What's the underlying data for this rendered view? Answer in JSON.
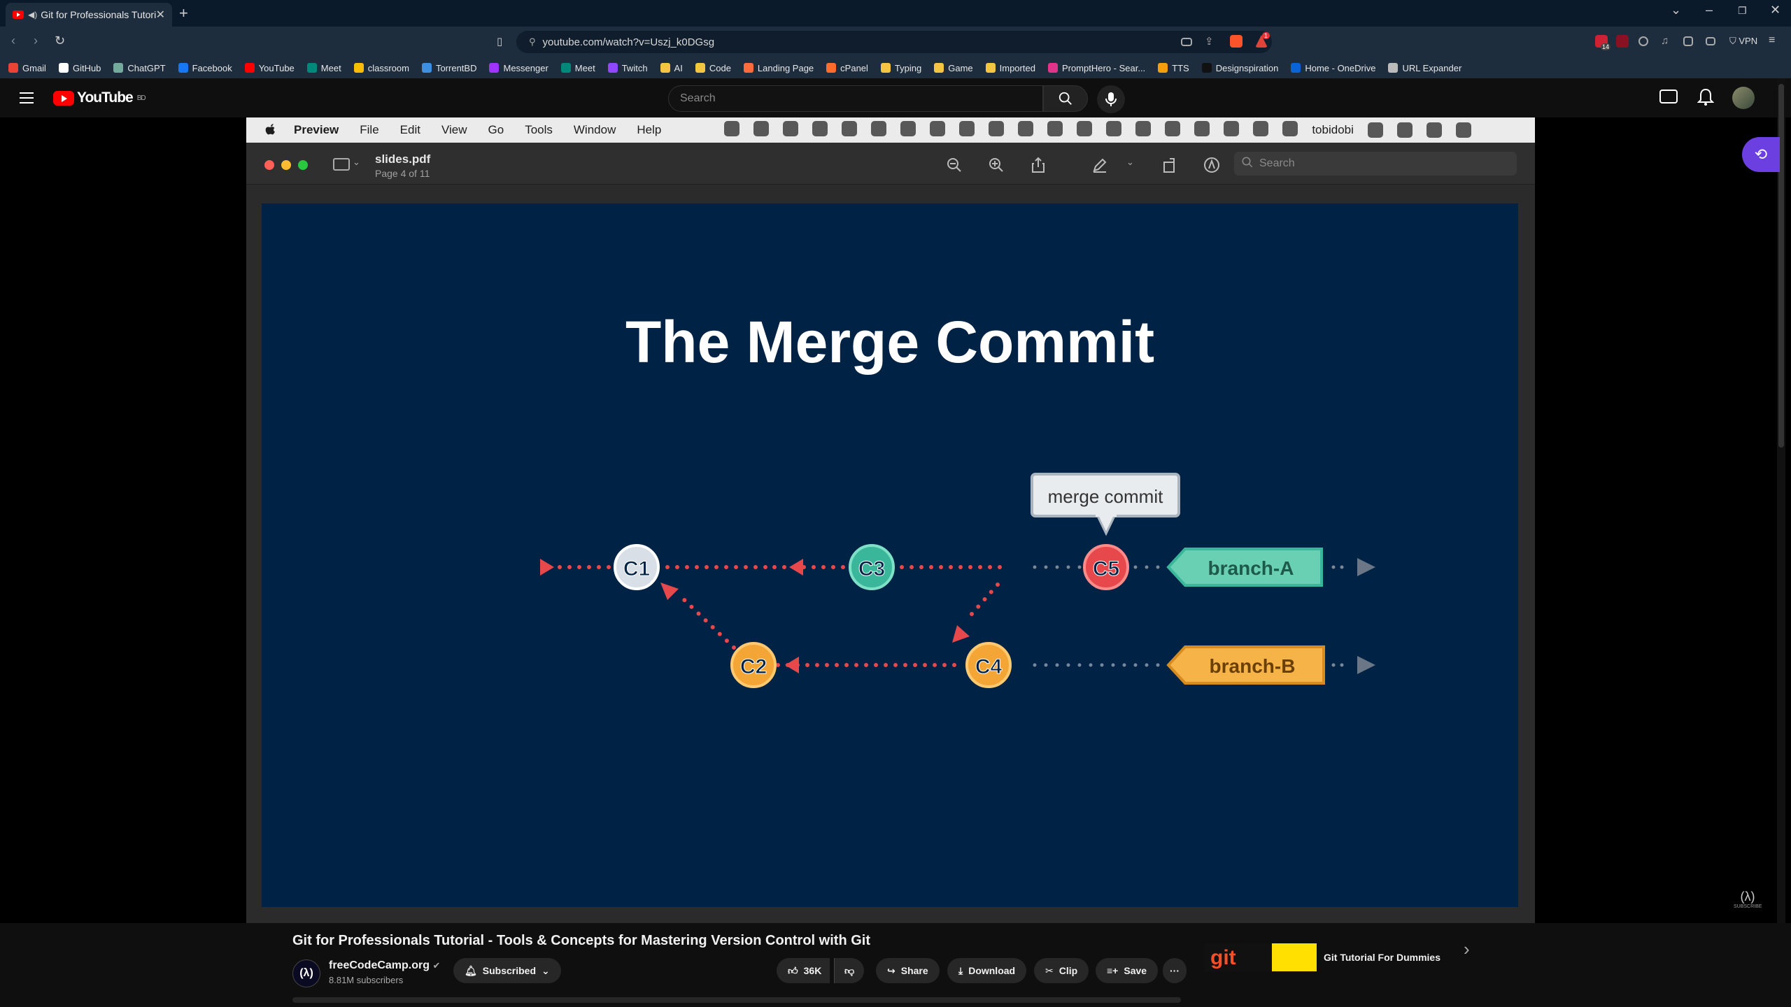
{
  "browser": {
    "tab_title": "Git for Professionals Tutorial",
    "new_tab": "+",
    "url": "youtube.com/watch?v=Uszj_k0DGsg",
    "vpn_label": "VPN",
    "badge_count": "14",
    "notif_count": "1",
    "bookmarks": [
      {
        "label": "Gmail",
        "color": "#ea4335"
      },
      {
        "label": "GitHub",
        "color": "#ffffff"
      },
      {
        "label": "ChatGPT",
        "color": "#74aa9c"
      },
      {
        "label": "Facebook",
        "color": "#1877f2"
      },
      {
        "label": "YouTube",
        "color": "#ff0000"
      },
      {
        "label": "Meet",
        "color": "#00897b"
      },
      {
        "label": "classroom",
        "color": "#fbbc04"
      },
      {
        "label": "TorrentBD",
        "color": "#3f8fe0"
      },
      {
        "label": "Messenger",
        "color": "#a033ff"
      },
      {
        "label": "Meet",
        "color": "#00897b"
      },
      {
        "label": "Twitch",
        "color": "#9146ff"
      },
      {
        "label": "AI",
        "color": "#f4c542"
      },
      {
        "label": "Code",
        "color": "#f4c542"
      },
      {
        "label": "Landing Page",
        "color": "#ff6b3d"
      },
      {
        "label": "cPanel",
        "color": "#ff6c2c"
      },
      {
        "label": "Typing",
        "color": "#f4c542"
      },
      {
        "label": "Game",
        "color": "#f4c542"
      },
      {
        "label": "Imported",
        "color": "#f4c542"
      },
      {
        "label": "PromptHero - Sear...",
        "color": "#e0338a"
      },
      {
        "label": "TTS",
        "color": "#f59e0b"
      },
      {
        "label": "Designspiration",
        "color": "#111111"
      },
      {
        "label": "Home - OneDrive",
        "color": "#0a64d6"
      },
      {
        "label": "URL Expander",
        "color": "#bbbbbb"
      }
    ]
  },
  "youtube": {
    "country_code": "BD",
    "search_placeholder": "Search",
    "video_title": "Git for Professionals Tutorial - Tools & Concepts for Mastering Version Control with Git",
    "channel_name": "freeCodeCamp.org",
    "channel_avatar": "(λ)",
    "subscribers": "8.81M subscribers",
    "subscribed_label": "Subscribed",
    "likes": "36K",
    "share_label": "Share",
    "download_label": "Download",
    "clip_label": "Clip",
    "save_label": "Save",
    "more_label": "···",
    "recommended_title": "Git Tutorial For Dummies",
    "recommended_thumb_text": "git",
    "next_arrow": "›",
    "watermark": "(λ)",
    "watermark_sub": "SUBSCRIBE"
  },
  "mac": {
    "menubar": [
      "Preview",
      "File",
      "Edit",
      "View",
      "Go",
      "Tools",
      "Window",
      "Help"
    ],
    "username": "tobidobi",
    "doc_name": "slides.pdf",
    "page_info": "Page 4 of 11",
    "search_placeholder": "Search"
  },
  "slide": {
    "title": "The Merge Commit",
    "callout": "merge commit",
    "commits": [
      "C1",
      "C2",
      "C3",
      "C4",
      "C5"
    ],
    "branches": [
      "branch-A",
      "branch-B"
    ],
    "colors": {
      "background": "#002244",
      "c1": "#d8dfe6",
      "teal": "#3ab79a",
      "orange": "#f3a536",
      "red": "#e6484c",
      "teal_label": "#6ad0b4",
      "orange_label": "#f6b347"
    }
  }
}
